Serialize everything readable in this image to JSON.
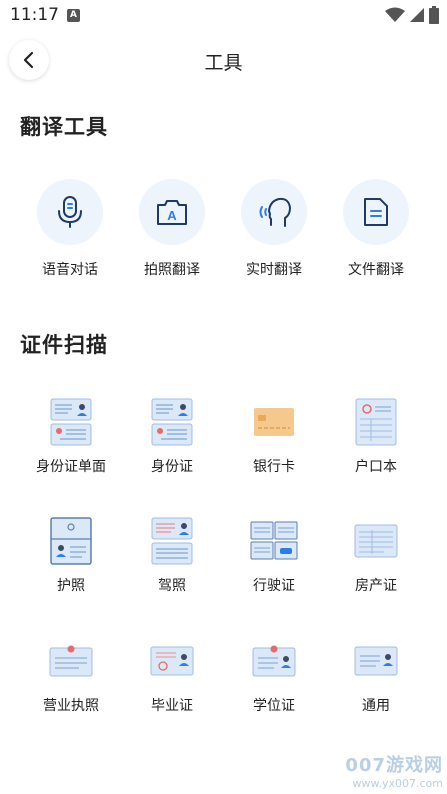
{
  "status": {
    "time": "11:17",
    "a_label": "A"
  },
  "header": {
    "title": "工具"
  },
  "translate_section": {
    "title": "翻译工具",
    "tools": [
      {
        "label": "语音对话",
        "icon": "microphone-icon"
      },
      {
        "label": "拍照翻译",
        "icon": "camera-icon"
      },
      {
        "label": "实时翻译",
        "icon": "speaking-head-icon"
      },
      {
        "label": "文件翻译",
        "icon": "document-icon"
      }
    ]
  },
  "scan_section": {
    "title": "证件扫描",
    "items": [
      {
        "label": "身份证单面",
        "icon": "id-card-single-icon"
      },
      {
        "label": "身份证",
        "icon": "id-card-icon"
      },
      {
        "label": "银行卡",
        "icon": "bank-card-icon"
      },
      {
        "label": "户口本",
        "icon": "household-register-icon"
      },
      {
        "label": "护照",
        "icon": "passport-icon"
      },
      {
        "label": "驾照",
        "icon": "drivers-license-icon"
      },
      {
        "label": "行驶证",
        "icon": "vehicle-license-icon"
      },
      {
        "label": "房产证",
        "icon": "property-certificate-icon"
      },
      {
        "label": "营业执照",
        "icon": "business-license-icon"
      },
      {
        "label": "毕业证",
        "icon": "diploma-icon"
      },
      {
        "label": "学位证",
        "icon": "degree-certificate-icon"
      },
      {
        "label": "通用",
        "icon": "general-document-icon"
      }
    ]
  },
  "watermark": {
    "main": "007游戏网",
    "sub": "www.yx007.com"
  },
  "colors": {
    "accent": "#2b7de9",
    "icon_bg": "#eef4fb",
    "card_blue": "#dbe8f7",
    "card_orange": "#f5c98d"
  }
}
